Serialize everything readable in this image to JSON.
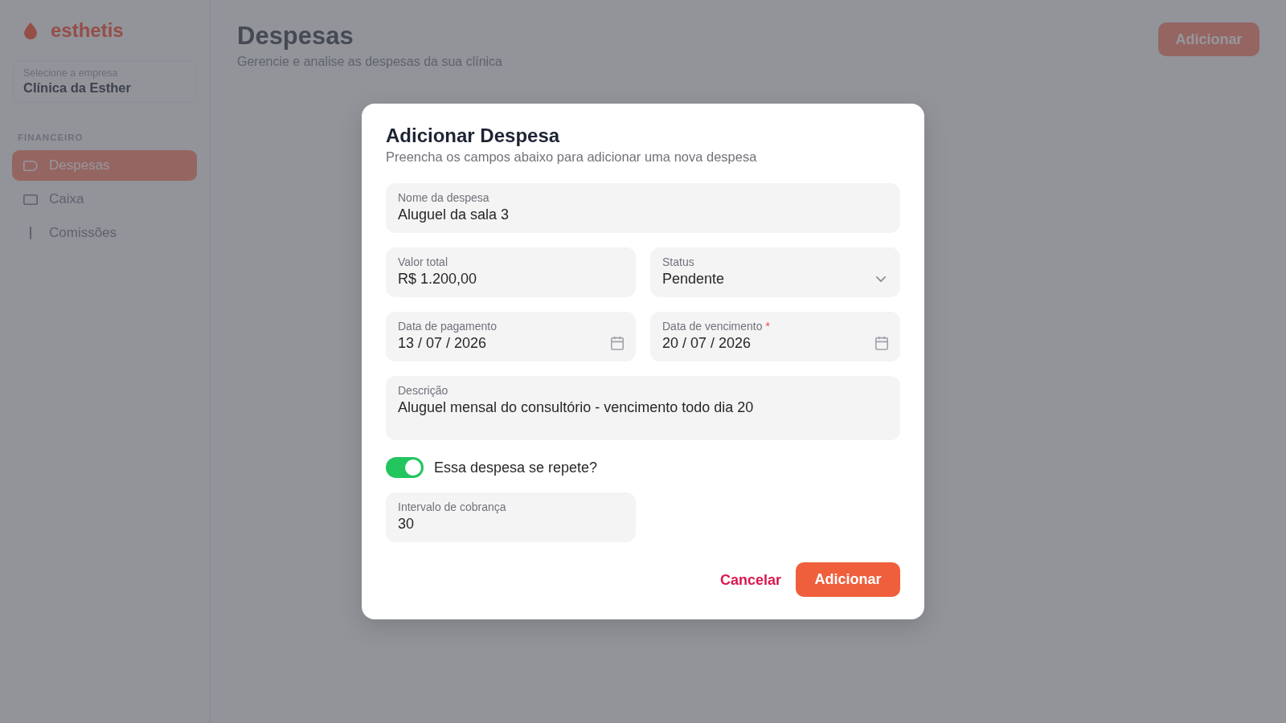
{
  "sidebar": {
    "brand": "esthetis",
    "company_select": {
      "label": "Selecione a empresa",
      "value": "Clínica da Esther"
    },
    "section_title": "FINANCEIRO",
    "items": [
      {
        "label": "Despesas",
        "selected": true
      },
      {
        "label": "Caixa",
        "selected": false
      },
      {
        "label": "Comissões",
        "selected": false
      }
    ]
  },
  "page": {
    "title": "Despesas",
    "subtitle": "Gerencie e analise as despesas da sua clínica",
    "add_button": "Adicionar"
  },
  "dialog": {
    "title": "Adicionar Despesa",
    "subtitle": "Preencha os campos abaixo para adicionar uma nova despesa",
    "name_field": {
      "label": "Nome da despesa",
      "value": "Aluguel da sala 3"
    },
    "amount_field": {
      "label": "Valor total",
      "value": "R$ 1.200,00"
    },
    "status_field": {
      "label": "Status",
      "value": "Pendente"
    },
    "payment_date_field": {
      "label": "Data de pagamento",
      "value": "13 / 07 / 2026"
    },
    "due_date_field": {
      "label": "Data de vencimento",
      "required_mark": "*",
      "value": "20 / 07 / 2026"
    },
    "description_field": {
      "label": "Descrição",
      "value": "Aluguel mensal do consultório - vencimento todo dia 20"
    },
    "recurring_toggle": {
      "label": "Essa despesa se repete?",
      "on": true
    },
    "interval_field": {
      "label": "Intervalo de cobrança",
      "value": "30"
    },
    "buttons": [
      {
        "kind": "text",
        "label": "Cancelar"
      },
      {
        "kind": "primary",
        "label": "Adicionar"
      }
    ]
  }
}
